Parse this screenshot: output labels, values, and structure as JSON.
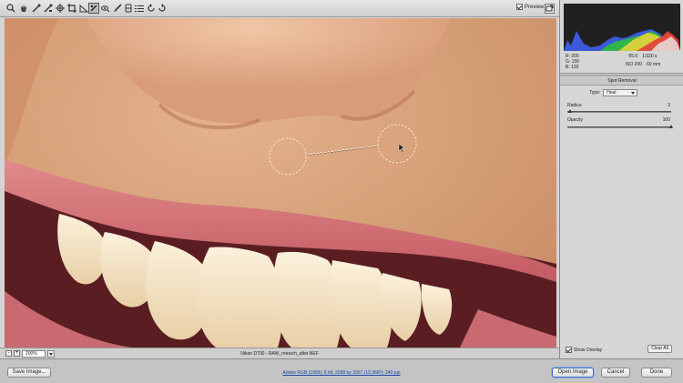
{
  "toolbar": {
    "tools": [
      "zoom-tool",
      "hand-tool",
      "white-balance-tool",
      "color-sampler-tool",
      "crop-tool",
      "straighten-tool",
      "spot-removal-tool",
      "red-eye-tool",
      "adjustment-brush-tool",
      "graduated-filter-tool",
      "preferences-tool",
      "rotate-ccw-tool",
      "rotate-cw-tool"
    ],
    "preview_label": "Preview",
    "preview_checked": true
  },
  "histogram": {
    "rgb": {
      "r_label": "R:",
      "r": "205",
      "g_label": "G:",
      "g": "156",
      "b_label": "B:",
      "b": "132"
    },
    "exposure": {
      "aperture": "f/5.6",
      "shutter": "1/320 s",
      "iso": "ISO 200",
      "focal": "60 mm"
    }
  },
  "panel": {
    "section_title": "Spot Removal",
    "type_label": "Type:",
    "type_value": "Heal",
    "radius_label": "Radius",
    "radius_value": "3",
    "radius_fraction": 0.03,
    "opacity_label": "Opacity",
    "opacity_value": "100",
    "opacity_fraction": 1.0,
    "show_overlay_label": "Show Overlay",
    "show_overlay_checked": true,
    "clear_all_label": "Clear All"
  },
  "status": {
    "zoom_minus": "-",
    "zoom_plus": "+",
    "zoom_value": "200%",
    "camera_filename": "Nikon D700  -  RAW_retouch_after.NEF"
  },
  "footer": {
    "save_image_label": "Save Image...",
    "workflow_link": "Adobe RGB (1998); 8 bit; 2588 by 3997 (10.3MP); 240 ppi",
    "open_image_label": "Open Image",
    "cancel_label": "Cancel",
    "done_label": "Done"
  },
  "colors": {
    "skin": "#d9a47e",
    "lip": "#c9575f",
    "teeth": "#f2e2c4",
    "accent_blue": "#3a6fbf"
  }
}
